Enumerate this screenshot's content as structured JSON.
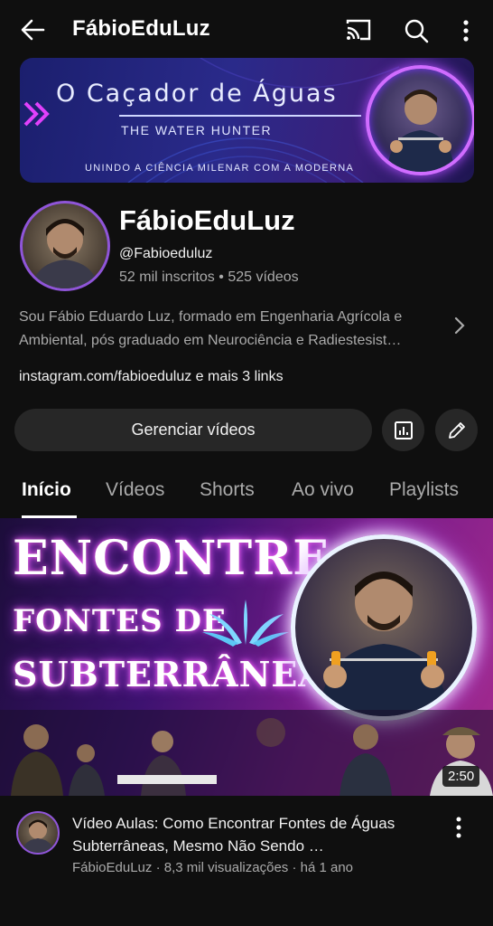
{
  "header": {
    "title": "FábioEduLuz",
    "icons": [
      "back-arrow-icon",
      "cast-icon",
      "search-icon",
      "more-vertical-icon"
    ]
  },
  "banner": {
    "title": "O Caçador de Águas",
    "subtitle": "THE WATER HUNTER",
    "tagline": "UNINDO A CIÊNCIA MILENAR COM A MODERNA"
  },
  "channel": {
    "name": "FábioEduLuz",
    "handle": "@Fabioeduluz",
    "subscribers": "52 mil inscritos",
    "separator": "•",
    "videos": "525 vídeos",
    "description": "Sou Fábio Eduardo Luz, formado em Engenharia Agrícola e Ambiental, pós graduado em Neurociência e Radiestesist…",
    "links": "instagram.com/fabioeduluz e mais 3 links"
  },
  "actions": {
    "manage_label": "Gerenciar vídeos"
  },
  "tabs": [
    {
      "label": "Início",
      "active": true
    },
    {
      "label": "Vídeos",
      "active": false
    },
    {
      "label": "Shorts",
      "active": false
    },
    {
      "label": "Ao vivo",
      "active": false
    },
    {
      "label": "Playlists",
      "active": false
    }
  ],
  "video": {
    "thumbnail_text": {
      "line1": "ENCONTRE",
      "line2": "FONTES DE",
      "line3": "SUBTERRÂNEAS"
    },
    "duration": "2:50",
    "title": "Vídeo Aulas: Como Encontrar Fontes de Águas Subterrâneas, Mesmo Não Sendo …",
    "meta": "FábioEduLuz · 8,3 mil visualizações · há 1 ano"
  },
  "colors": {
    "background": "#0f0f0f",
    "button": "#272727",
    "secondary_text": "#aaaaaa",
    "avatar_ring": "#8f55d8"
  }
}
